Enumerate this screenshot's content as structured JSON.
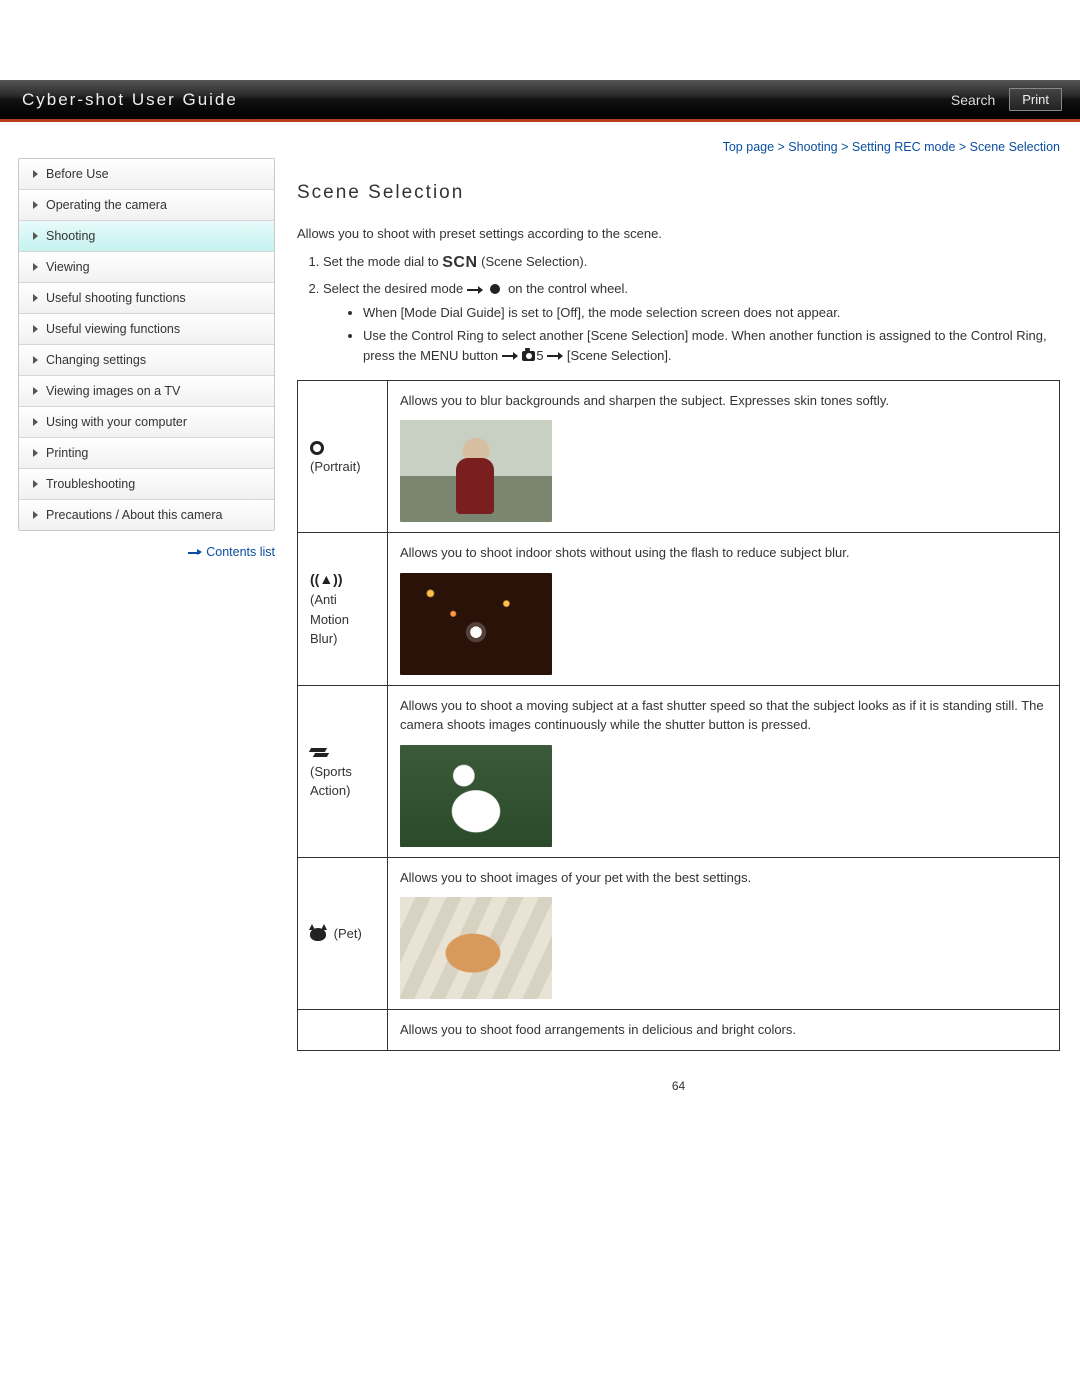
{
  "header": {
    "title": "Cyber-shot User Guide",
    "search": "Search",
    "print": "Print"
  },
  "breadcrumb": "Top page > Shooting > Setting REC mode > Scene Selection",
  "sidebar": {
    "items": [
      {
        "label": "Before Use"
      },
      {
        "label": "Operating the camera"
      },
      {
        "label": "Shooting"
      },
      {
        "label": "Viewing"
      },
      {
        "label": "Useful shooting functions"
      },
      {
        "label": "Useful viewing functions"
      },
      {
        "label": "Changing settings"
      },
      {
        "label": "Viewing images on a TV"
      },
      {
        "label": "Using with your computer"
      },
      {
        "label": "Printing"
      },
      {
        "label": "Troubleshooting"
      },
      {
        "label": "Precautions / About this camera"
      }
    ],
    "active_index": 2,
    "contents_list": "Contents list"
  },
  "page_title": "Scene Selection",
  "intro": "Allows you to shoot with preset settings according to the scene.",
  "steps": {
    "s1a": "Set the mode dial to ",
    "s1_icon": "SCN",
    "s1b": "(Scene Selection).",
    "s2a": "Select the desired mode ",
    "s2b": " on the control wheel.",
    "sub1": "When [Mode Dial Guide] is set to [Off], the mode selection screen does not appear.",
    "sub2a": "Use the Control Ring to select another [Scene Selection] mode. When another function is assigned to the Control Ring, press the MENU button ",
    "sub2_num": "5",
    "sub2b": " [Scene Selection]."
  },
  "modes": [
    {
      "name": " (Portrait)",
      "desc": "Allows you to blur backgrounds and sharpen the subject. Expresses skin tones softly.",
      "thumb_class": "portrait",
      "icon": "portrait"
    },
    {
      "name": " (Anti Motion Blur)",
      "desc": "Allows you to shoot indoor shots without using the flash to reduce subject blur.",
      "thumb_class": "motion",
      "icon": "motion"
    },
    {
      "name": " (Sports Action)",
      "desc": "Allows you to shoot a moving subject at a fast shutter speed so that the subject looks as if it is standing still. The camera shoots images continuously while the shutter button is pressed.",
      "thumb_class": "sports",
      "icon": "sports"
    },
    {
      "name": " (Pet)",
      "desc": "Allows you to shoot images of your pet with the best settings.",
      "thumb_class": "pet",
      "icon": "pet"
    },
    {
      "name": "",
      "desc": "Allows you to shoot food arrangements in delicious and bright colors.",
      "thumb_class": "",
      "icon": ""
    }
  ],
  "page_number": "64"
}
